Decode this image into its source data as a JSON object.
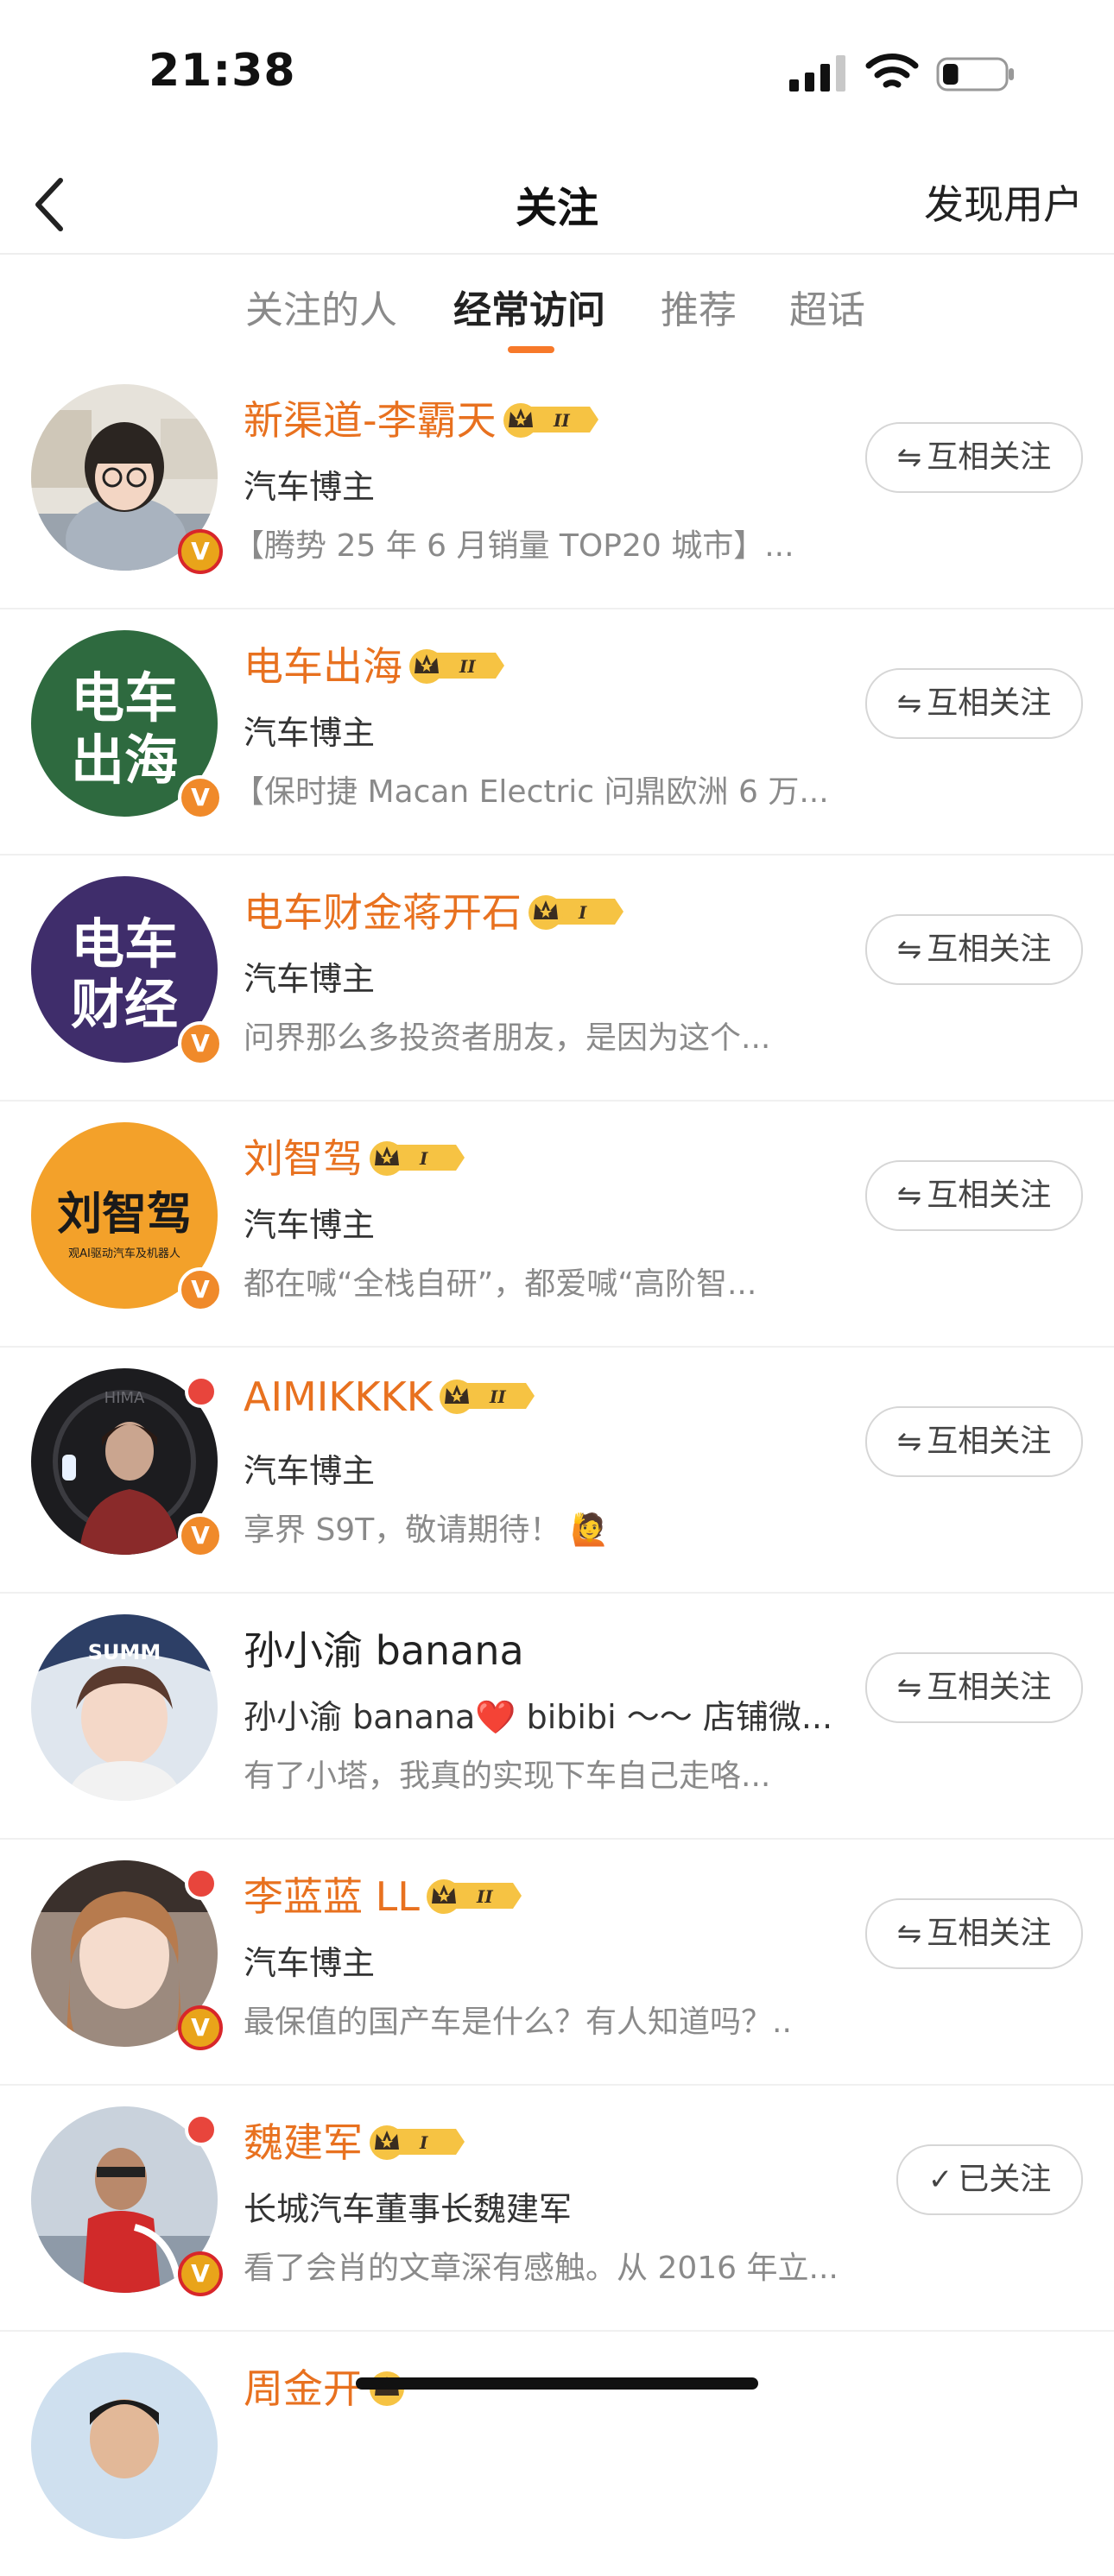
{
  "status_bar": {
    "time": "21:38",
    "battery_level": 0.25
  },
  "nav": {
    "title": "关注",
    "discover_label": "发现用户"
  },
  "tabs": [
    {
      "label": "关注的人",
      "active": false
    },
    {
      "label": "经常访问",
      "active": true
    },
    {
      "label": "推荐",
      "active": false
    },
    {
      "label": "超话",
      "active": false
    }
  ],
  "colors": {
    "accent": "#f7792a",
    "name_orange": "#e8711f",
    "live_red": "#e8453c"
  },
  "users": [
    {
      "name": "新渠道-李霸天",
      "rank": "II",
      "desc": "汽车博主",
      "post": "【腾势 25 年 6 月销量 TOP20 城市】...",
      "follow_label": "互相关注",
      "follow_icon": "mutual-arrows-icon",
      "verified": "gold",
      "live": false
    },
    {
      "name": "电车出海",
      "rank": "II",
      "desc": "汽车博主",
      "post": "【保时捷 Macan Electric 问鼎欧洲 6 万...",
      "follow_label": "互相关注",
      "follow_icon": "mutual-arrows-icon",
      "verified": "orange",
      "live": false
    },
    {
      "name": "电车财金蒋开石",
      "rank": "I",
      "desc": "汽车博主",
      "post": "问界那么多投资者朋友，是因为这个...",
      "follow_label": "互相关注",
      "follow_icon": "mutual-arrows-icon",
      "verified": "orange",
      "live": false
    },
    {
      "name": "刘智驾",
      "rank": "I",
      "desc": "汽车博主",
      "post": "都在喊“全栈自研”，都爱喊“高阶智...",
      "follow_label": "互相关注",
      "follow_icon": "mutual-arrows-icon",
      "verified": "orange",
      "live": false
    },
    {
      "name": "AIMIKKKK",
      "rank": "II",
      "desc": "汽车博主",
      "post": "享界 S9T，敬请期待！ 🙋",
      "follow_label": "互相关注",
      "follow_icon": "mutual-arrows-icon",
      "verified": "orange",
      "live": true
    },
    {
      "name": "孙小渝 banana",
      "rank": "",
      "desc": "孙小渝 banana❤️ bibibi ～～ 店铺微...",
      "post": "有了小塔，我真的实现下车自己走咯...",
      "follow_label": "互相关注",
      "follow_icon": "mutual-arrows-icon",
      "verified": "",
      "live": false
    },
    {
      "name": "李蓝蓝 LL",
      "rank": "II",
      "desc": "汽车博主",
      "post": "最保值的国产车是什么？有人知道吗？..",
      "follow_label": "互相关注",
      "follow_icon": "mutual-arrows-icon",
      "verified": "gold",
      "live": true
    },
    {
      "name": "魏建军",
      "rank": "I",
      "desc": "长城汽车董事长魏建军",
      "post": "看了会肖的文章深有感触。从 2016 年立...",
      "follow_label": "已关注",
      "follow_icon": "check-icon",
      "verified": "gold",
      "live": true
    },
    {
      "name": "周金开",
      "rank": "",
      "desc": "",
      "post": "",
      "follow_label": "",
      "follow_icon": "",
      "verified": "",
      "live": false
    }
  ],
  "avatar_texts": {
    "dianche_chuhai": [
      "电车",
      "出海"
    ],
    "dianche_caijing": [
      "电车",
      "财经"
    ],
    "liu_zhijia": "刘智驾",
    "liu_zhijia_sub": "观AI驱动汽车及机器人",
    "himax": "HIMA",
    "summer": "SUMM"
  }
}
